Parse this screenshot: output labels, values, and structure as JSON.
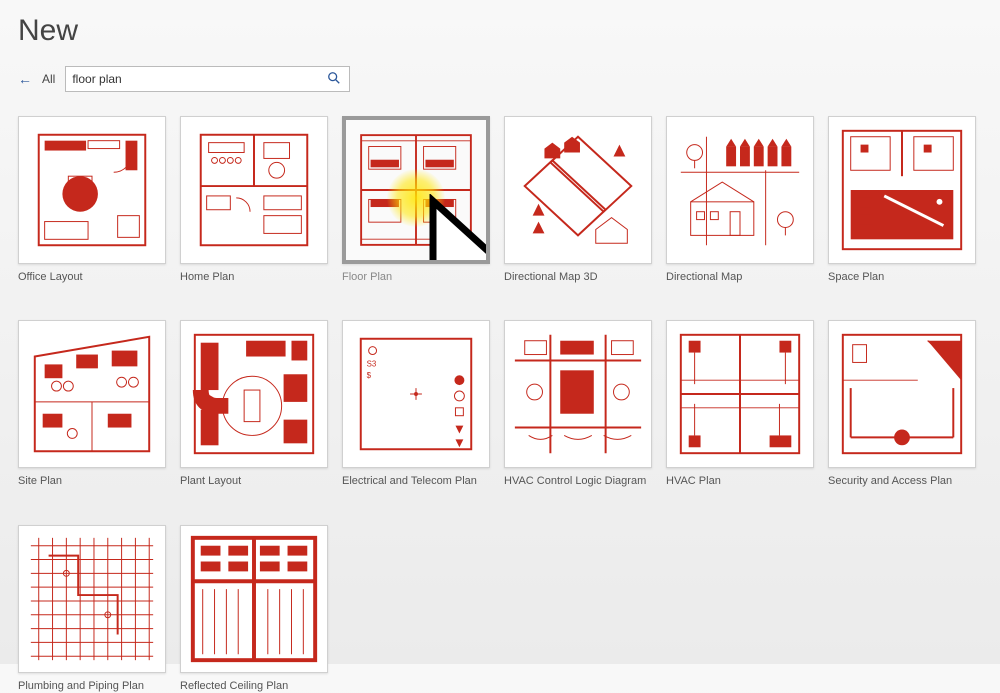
{
  "page": {
    "title": "New"
  },
  "nav": {
    "back_label": "←",
    "all_label": "All"
  },
  "search": {
    "value": "floor plan",
    "placeholder": ""
  },
  "templates": [
    {
      "label": "Office Layout",
      "selected": false
    },
    {
      "label": "Home Plan",
      "selected": false
    },
    {
      "label": "Floor Plan",
      "selected": true
    },
    {
      "label": "Directional Map 3D",
      "selected": false
    },
    {
      "label": "Directional Map",
      "selected": false
    },
    {
      "label": "Space Plan",
      "selected": false
    },
    {
      "label": "Site Plan",
      "selected": false
    },
    {
      "label": "Plant Layout",
      "selected": false
    },
    {
      "label": "Electrical and Telecom Plan",
      "selected": false
    },
    {
      "label": "HVAC Control Logic Diagram",
      "selected": false
    },
    {
      "label": "HVAC Plan",
      "selected": false
    },
    {
      "label": "Security and Access Plan",
      "selected": false
    },
    {
      "label": "Plumbing and Piping Plan",
      "selected": false
    },
    {
      "label": "Reflected Ceiling Plan",
      "selected": false
    }
  ]
}
